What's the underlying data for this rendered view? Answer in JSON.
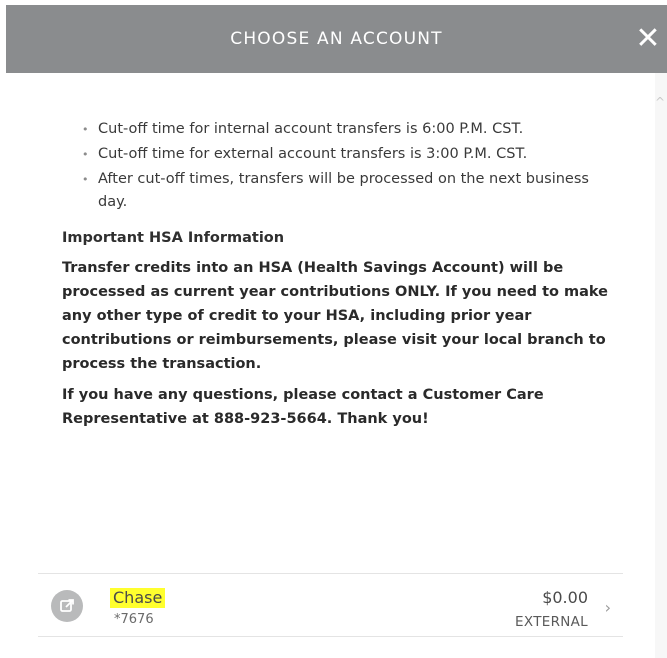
{
  "header": {
    "title": "CHOOSE AN ACCOUNT",
    "close_glyph": "✕"
  },
  "cutoff": {
    "items": [
      "Cut-off time for internal account transfers is 6:00 P.M. CST.",
      "Cut-off time for external account transfers is 3:00 P.M. CST.",
      "After cut-off times, transfers will be processed on the next business day."
    ]
  },
  "hsa": {
    "heading": "Important HSA Information",
    "body": "Transfer credits into an HSA (Health Savings Account) will be processed as current year contributions ONLY.  If you need to make any other type of credit to your HSA, including prior year contributions or reimbursements, please visit your local branch to process the transaction.",
    "contact": "If you have any questions, please contact a Customer Care Representative at 888-923-5664.  Thank you!"
  },
  "accounts": [
    {
      "name": "Chase",
      "number": "*7676",
      "balance": "$0.00",
      "type": "EXTERNAL",
      "icon": "external-link-icon"
    }
  ],
  "colors": {
    "header_bg": "#8a8c8e",
    "highlight": "#ffff2e",
    "icon_bg": "#b9babb"
  }
}
